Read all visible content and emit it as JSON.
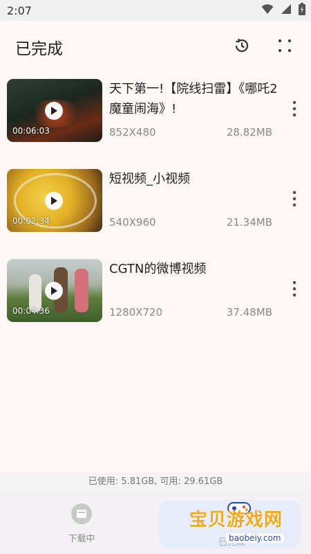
{
  "status_bar": {
    "time": "2:07"
  },
  "header": {
    "title": "已完成"
  },
  "videos": [
    {
      "title": "天下第一!【院线扫雷】《哪吒2魔童闹海》!",
      "duration": "00:06:03",
      "resolution": "852X480",
      "size": "28.82MB"
    },
    {
      "title": "短视频_小视频",
      "duration": "00:02:34",
      "resolution": "540X960",
      "size": "21.34MB"
    },
    {
      "title": "CGTN的微博视频",
      "duration": "00:04:36",
      "resolution": "1280X720",
      "size": "37.48MB"
    }
  ],
  "storage": {
    "text": "已使用: 5.81GB, 可用: 29.61GB"
  },
  "bottom_nav": {
    "downloading_label": "下载中",
    "completed_label": "已完成"
  },
  "watermark": {
    "title": "宝贝游戏网",
    "url": "baobeiy.com"
  },
  "colors": {
    "accent": "#f1a91f",
    "background": "#fdf7f5",
    "secondary_text": "#8a8a8a"
  }
}
